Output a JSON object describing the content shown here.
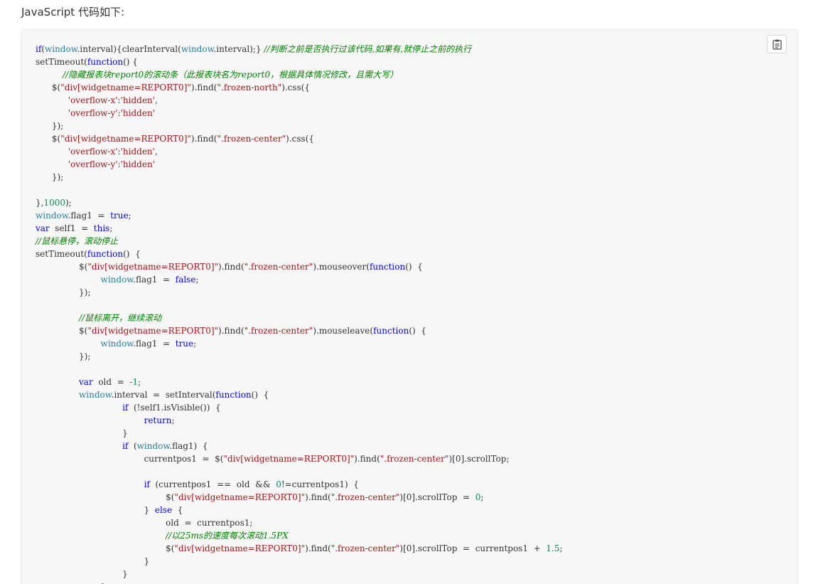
{
  "heading": "JavaScript 代码如下:",
  "toolbar": {
    "copy_icon": "clipboard-icon"
  },
  "colors": {
    "keyword": "#0000ff",
    "string": "#a31515",
    "number": "#09885a",
    "comment": "#008000",
    "object": "#267f99",
    "plain": "#333333",
    "card_background": "#f7f7f7"
  },
  "code": [
    [
      [
        "if",
        "kw"
      ],
      [
        "(",
        ""
      ],
      [
        "window",
        "obj"
      ],
      [
        ".interval){clearInterval(",
        ""
      ],
      [
        "window",
        "obj"
      ],
      [
        ".interval);} ",
        ""
      ],
      [
        "//判断之前是否执行过该代码,如果有,就停止之前的执行",
        "com"
      ]
    ],
    [
      [
        "setTimeout(",
        ""
      ],
      [
        "function",
        "kw"
      ],
      [
        "() {",
        ""
      ]
    ],
    [
      [
        "          ",
        ""
      ],
      [
        "//隐藏报表块report0的滚动条（此报表块名为report0，根据具体情况修改，且需大写）",
        "com"
      ]
    ],
    [
      [
        "      $(",
        ""
      ],
      [
        "\"div[widgetname=REPORT0]\"",
        "str"
      ],
      [
        ").find(",
        ""
      ],
      [
        "\".frozen-north\"",
        "str"
      ],
      [
        ").css({",
        ""
      ]
    ],
    [
      [
        "            ",
        ""
      ],
      [
        "'overflow-x'",
        "str"
      ],
      [
        ":",
        ""
      ],
      [
        "'hidden'",
        "str"
      ],
      [
        ",",
        ""
      ]
    ],
    [
      [
        "            ",
        ""
      ],
      [
        "'overflow-y'",
        "str"
      ],
      [
        ":",
        ""
      ],
      [
        "'hidden'",
        "str"
      ]
    ],
    [
      [
        "      });",
        ""
      ]
    ],
    [
      [
        "      $(",
        ""
      ],
      [
        "\"div[widgetname=REPORT0]\"",
        "str"
      ],
      [
        ").find(",
        ""
      ],
      [
        "\".frozen-center\"",
        "str"
      ],
      [
        ").css({",
        ""
      ]
    ],
    [
      [
        "            ",
        ""
      ],
      [
        "'overflow-x'",
        "str"
      ],
      [
        ":",
        ""
      ],
      [
        "'hidden'",
        "str"
      ],
      [
        ",",
        ""
      ]
    ],
    [
      [
        "            ",
        ""
      ],
      [
        "'overflow-y'",
        "str"
      ],
      [
        ":",
        ""
      ],
      [
        "'hidden'",
        "str"
      ]
    ],
    [
      [
        "      });",
        ""
      ]
    ],
    [
      [
        "",
        ""
      ]
    ],
    [
      [
        "},",
        ""
      ],
      [
        "1000",
        "num"
      ],
      [
        ");",
        ""
      ]
    ],
    [
      [
        "window",
        "obj"
      ],
      [
        ".flag1  =  ",
        ""
      ],
      [
        "true",
        "kw"
      ],
      [
        ";",
        ""
      ]
    ],
    [
      [
        "var",
        "kw"
      ],
      [
        "  self1  =  ",
        ""
      ],
      [
        "this",
        "kw"
      ],
      [
        ";",
        ""
      ]
    ],
    [
      [
        "//鼠标悬停，滚动停止",
        "com"
      ]
    ],
    [
      [
        "setTimeout(",
        ""
      ],
      [
        "function",
        "kw"
      ],
      [
        "()  {",
        ""
      ]
    ],
    [
      [
        "                $(",
        ""
      ],
      [
        "\"div[widgetname=REPORT0]\"",
        "str"
      ],
      [
        ").find(",
        ""
      ],
      [
        "\".frozen-center\"",
        "str"
      ],
      [
        ").mouseover(",
        ""
      ],
      [
        "function",
        "kw"
      ],
      [
        "()  {",
        ""
      ]
    ],
    [
      [
        "                        ",
        ""
      ],
      [
        "window",
        "obj"
      ],
      [
        ".flag1  =  ",
        ""
      ],
      [
        "false",
        "kw"
      ],
      [
        ";",
        ""
      ]
    ],
    [
      [
        "                });",
        ""
      ]
    ],
    [
      [
        "",
        ""
      ]
    ],
    [
      [
        "                ",
        ""
      ],
      [
        "//鼠标离开，继续滚动",
        "com"
      ]
    ],
    [
      [
        "                $(",
        ""
      ],
      [
        "\"div[widgetname=REPORT0]\"",
        "str"
      ],
      [
        ").find(",
        ""
      ],
      [
        "\".frozen-center\"",
        "str"
      ],
      [
        ").mouseleave(",
        ""
      ],
      [
        "function",
        "kw"
      ],
      [
        "()  {",
        ""
      ]
    ],
    [
      [
        "                        ",
        ""
      ],
      [
        "window",
        "obj"
      ],
      [
        ".flag1  =  ",
        ""
      ],
      [
        "true",
        "kw"
      ],
      [
        ";",
        ""
      ]
    ],
    [
      [
        "                });",
        ""
      ]
    ],
    [
      [
        "",
        ""
      ]
    ],
    [
      [
        "                ",
        ""
      ],
      [
        "var",
        "kw"
      ],
      [
        "  old  =  ",
        ""
      ],
      [
        "-1",
        "num"
      ],
      [
        ";",
        ""
      ]
    ],
    [
      [
        "                ",
        ""
      ],
      [
        "window",
        "obj"
      ],
      [
        ".interval  =  setInterval(",
        ""
      ],
      [
        "function",
        "kw"
      ],
      [
        "()  {",
        ""
      ]
    ],
    [
      [
        "                                ",
        ""
      ],
      [
        "if",
        "kw"
      ],
      [
        "  (!self1.isVisible())  {",
        ""
      ]
    ],
    [
      [
        "                                        ",
        ""
      ],
      [
        "return",
        "kw"
      ],
      [
        ";",
        ""
      ]
    ],
    [
      [
        "                                }",
        ""
      ]
    ],
    [
      [
        "                                ",
        ""
      ],
      [
        "if",
        "kw"
      ],
      [
        "  (",
        ""
      ],
      [
        "window",
        "obj"
      ],
      [
        ".flag1)  {",
        ""
      ]
    ],
    [
      [
        "                                        currentpos1  =  $(",
        ""
      ],
      [
        "\"div[widgetname=REPORT0]\"",
        "str"
      ],
      [
        ").find(",
        ""
      ],
      [
        "\".frozen-center\"",
        "str"
      ],
      [
        ")[0].scrollTop;",
        ""
      ]
    ],
    [
      [
        "",
        ""
      ]
    ],
    [
      [
        "                                        ",
        ""
      ],
      [
        "if",
        "kw"
      ],
      [
        "  (currentpos1  ==  old  &&  ",
        ""
      ],
      [
        "0",
        "num"
      ],
      [
        "!=currentpos1)  {",
        ""
      ]
    ],
    [
      [
        "                                                $(",
        ""
      ],
      [
        "\"div[widgetname=REPORT0]\"",
        "str"
      ],
      [
        ").find(",
        ""
      ],
      [
        "\".frozen-center\"",
        "str"
      ],
      [
        ")[0].scrollTop  =  ",
        ""
      ],
      [
        "0",
        "num"
      ],
      [
        ";",
        ""
      ]
    ],
    [
      [
        "                                        }  ",
        ""
      ],
      [
        "else",
        "kw"
      ],
      [
        "  {",
        ""
      ]
    ],
    [
      [
        "                                                old  =  currentpos1;",
        ""
      ]
    ],
    [
      [
        "                                                ",
        ""
      ],
      [
        "//以25ms的速度每次滚动1.5PX",
        "com"
      ]
    ],
    [
      [
        "                                                $(",
        ""
      ],
      [
        "\"div[widgetname=REPORT0]\"",
        "str"
      ],
      [
        ").find(",
        ""
      ],
      [
        "\".frozen-center\"",
        "str"
      ],
      [
        ")[0].scrollTop  =  currentpos1  +  ",
        ""
      ],
      [
        "1.5",
        "num"
      ],
      [
        ";",
        ""
      ]
    ],
    [
      [
        "                                        }",
        ""
      ]
    ],
    [
      [
        "                                }",
        ""
      ]
    ],
    [
      [
        "                        },",
        ""
      ]
    ]
  ]
}
